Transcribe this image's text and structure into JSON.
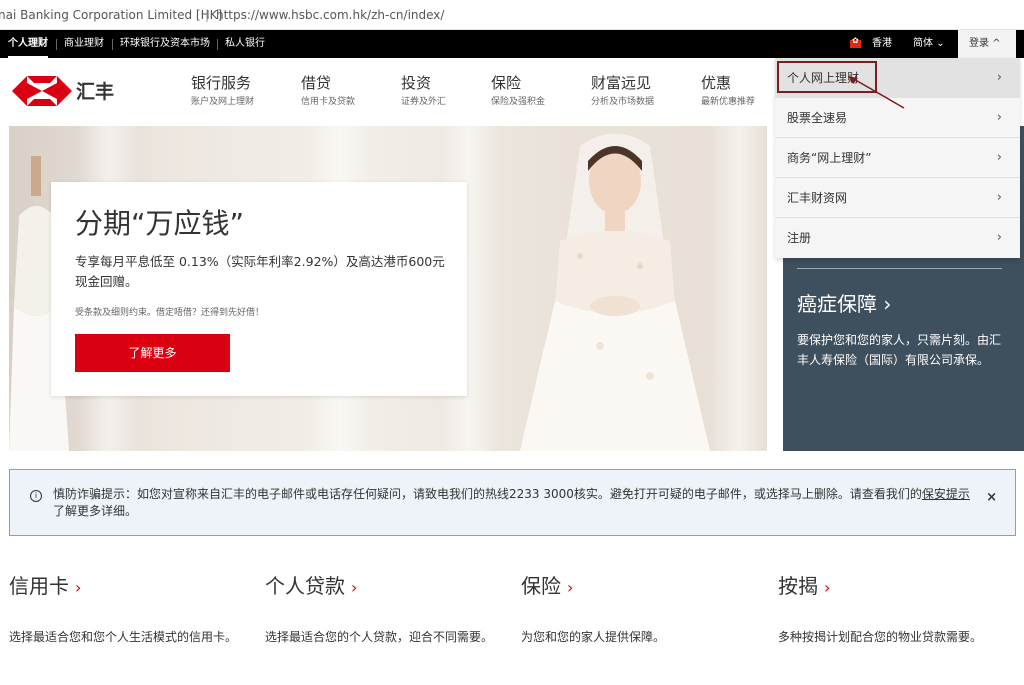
{
  "browser": {
    "title_fragment": "nai Banking Corporation Limited [HK]",
    "separator": "|",
    "url": "https://www.hsbc.com.hk/zh-cn/index/"
  },
  "topbar": {
    "segments": [
      "个人理财",
      "商业理财",
      "环球银行及资本市场",
      "私人银行"
    ],
    "region": "香港",
    "language": "简体",
    "login": "登录"
  },
  "logo": {
    "text": "汇丰",
    "colors": {
      "red": "#db0011",
      "white": "#ffffff"
    }
  },
  "nav": [
    {
      "title": "银行服务",
      "sub": "账户及网上理财"
    },
    {
      "title": "借贷",
      "sub": "信用卡及贷款"
    },
    {
      "title": "投资",
      "sub": "证券及外汇"
    },
    {
      "title": "保险",
      "sub": "保险及强积金"
    },
    {
      "title": "财富远见",
      "sub": "分析及市场数据"
    },
    {
      "title": "优惠",
      "sub": "最新优惠推荐"
    }
  ],
  "dropdown": [
    {
      "label": "个人网上理财"
    },
    {
      "label": "股票全速易"
    },
    {
      "label": "商务“网上理财”"
    },
    {
      "label": "汇丰财资网"
    },
    {
      "label": "注册"
    }
  ],
  "hero": {
    "title": "分期“万应钱”",
    "description": "专享每月平息低至 0.13%（实际年利率2.92%）及高达港币600元现金回赠。",
    "terms": "受条款及细则约束。借定唔借？还得到先好借！",
    "cta": "了解更多"
  },
  "promo": {
    "title": "癌症保障 ›",
    "body": "要保护您和您的家人，只需片刻。由汇丰人寿保险（国际）有限公司承保。"
  },
  "alert": {
    "icon": "info-icon",
    "text_before": "慎防诈骗提示：如您对宣称来自汇丰的电子邮件或电话存任何疑问，请致电我们的热线2233 3000核实。避免打开可疑的电子邮件，或选择马上删除。请查看我们的",
    "link": "保安提示",
    "text_after": "了解更多详细。",
    "close": "×"
  },
  "products": [
    {
      "title": "信用卡",
      "desc": "选择最适合您和您个人生活模式的信用卡。"
    },
    {
      "title": "个人贷款",
      "desc": "选择最适合您的个人贷款，迎合不同需要。"
    },
    {
      "title": "保险",
      "desc": "为您和您的家人提供保障。"
    },
    {
      "title": "按揭",
      "desc": "多种按揭计划配合您的物业贷款需要。"
    }
  ],
  "colors": {
    "accent": "#db0011",
    "promo_bg": "#3e505d",
    "alert_border": "#7da3c4"
  }
}
